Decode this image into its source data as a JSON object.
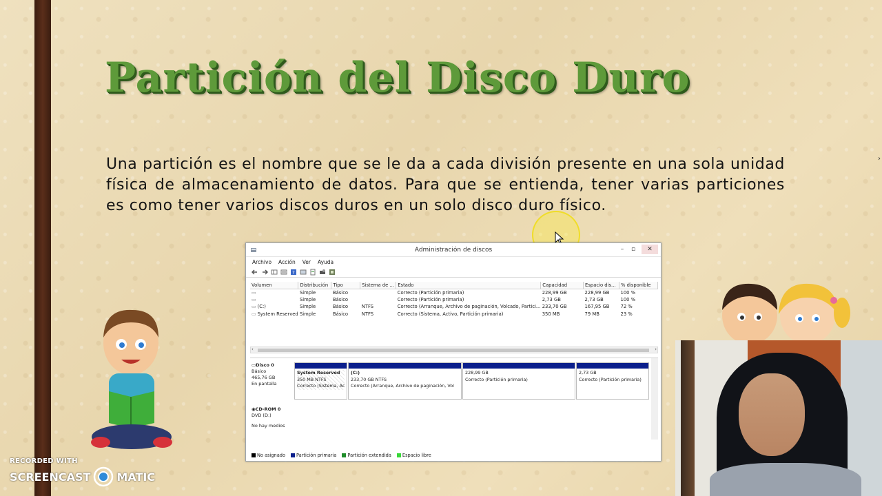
{
  "slide": {
    "title": "Partición del Disco Duro",
    "paragraph": "Una partición es el nombre que se le da a cada división presente en una sola unidad física de almacenamiento de datos. Para que se entienda, tener varias particiones es como tener varios discos duros en un solo disco duro físico."
  },
  "window": {
    "title": "Administración de discos",
    "menu": [
      "Archivo",
      "Acción",
      "Ver",
      "Ayuda"
    ],
    "columns": [
      "Volumen",
      "Distribución",
      "Tipo",
      "Sistema de ...",
      "Estado",
      "Capacidad",
      "Espacio dis...",
      "% disponible"
    ],
    "rows": [
      [
        "",
        "Simple",
        "Básico",
        "",
        "Correcto (Partición primaria)",
        "228,99 GB",
        "228,99 GB",
        "100 %"
      ],
      [
        "",
        "Simple",
        "Básico",
        "",
        "Correcto (Partición primaria)",
        "2,73 GB",
        "2,73 GB",
        "100 %"
      ],
      [
        "(C:)",
        "Simple",
        "Básico",
        "NTFS",
        "Correcto (Arranque, Archivo de paginación, Volcado, Partici...",
        "233,70 GB",
        "167,95 GB",
        "72 %"
      ],
      [
        "System Reserved",
        "Simple",
        "Básico",
        "NTFS",
        "Correcto (Sistema, Activo, Partición primaria)",
        "350 MB",
        "79 MB",
        "23 %"
      ]
    ],
    "disk0": {
      "name": "Disco 0",
      "type": "Básico",
      "size": "465,76 GB",
      "status": "En pantalla",
      "partitions": [
        {
          "name": "System Reserved",
          "size": "350 MB NTFS",
          "status": "Correcto (Sistema, Ac"
        },
        {
          "name": "(C:)",
          "size": "233,70 GB NTFS",
          "status": "Correcto (Arranque, Archivo de paginación, Vol"
        },
        {
          "name": "",
          "size": "228,99 GB",
          "status": "Correcto (Partición primaria)"
        },
        {
          "name": "",
          "size": "2,73 GB",
          "status": "Correcto (Partición primaria)"
        }
      ]
    },
    "cdrom": {
      "name": "CD-ROM 0",
      "type": "DVD (D:)",
      "status": "No hay medios"
    },
    "legend": [
      {
        "label": "No asignado",
        "color": "#000000"
      },
      {
        "label": "Partición primaria",
        "color": "#0b1f8c"
      },
      {
        "label": "Partición extendida",
        "color": "#1f8c2a"
      },
      {
        "label": "Espacio libre",
        "color": "#38d838"
      }
    ]
  },
  "watermark": {
    "recorded": "RECORDED WITH",
    "brand_left": "SCREENCAST",
    "brand_right": "MATIC"
  },
  "colors": {
    "title_green": "#5e9a3a",
    "partition_blue": "#0b1f8c",
    "left_bar": "#4a2414"
  }
}
